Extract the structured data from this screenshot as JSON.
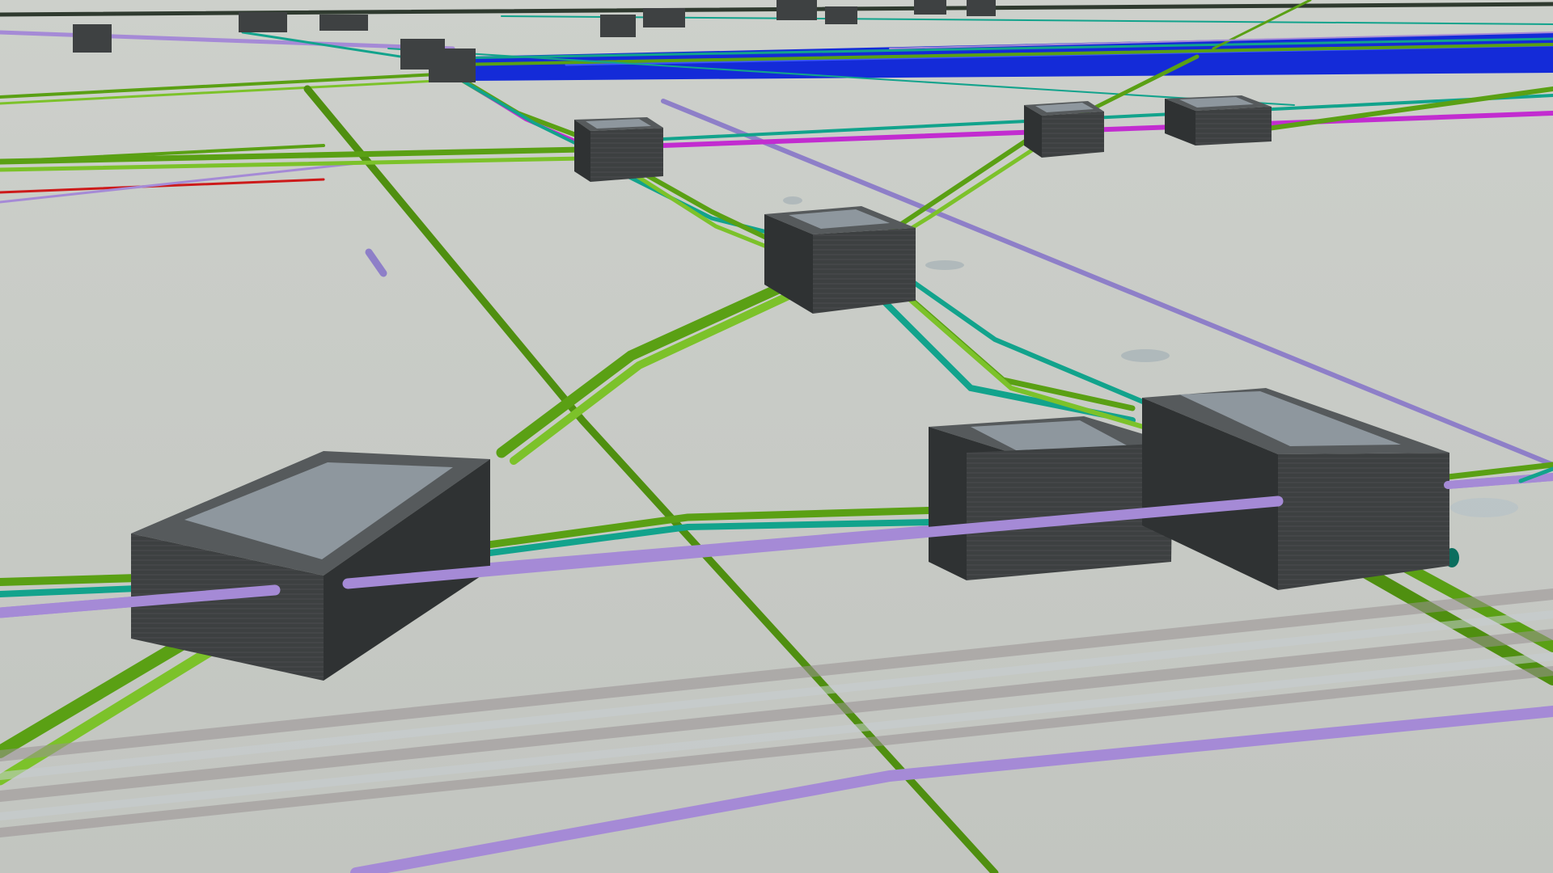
{
  "scene": {
    "background": "#c6c9c4",
    "colors": {
      "green": "#5aa014",
      "green_light": "#7cc22a",
      "teal": "#12a38c",
      "purple": "#a58ad6",
      "magenta": "#c22cd0",
      "blue": "#0a22d8",
      "red": "#cc1a1a",
      "grey_pipe": "#a9a0a2",
      "chamber_side": "#3e4142",
      "chamber_top": "#565a5c",
      "chamber_lid": "#8e979e"
    },
    "objects": [
      "pipe-network",
      "utility-chamber",
      "cable-duct",
      "transparent-ducts",
      "manhole-disc"
    ]
  }
}
